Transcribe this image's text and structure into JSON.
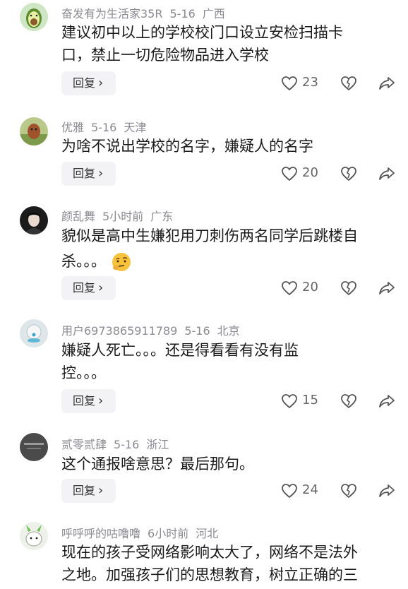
{
  "comments": [
    {
      "username": "奋发有为生活家35R",
      "date": "5-16",
      "location": "广西",
      "text_lines": [
        "建议初中以上的学校校门口设立安检扫描卡",
        "口，禁止一切危险物品进入学校"
      ],
      "reply_label": "回复",
      "like_count": "23",
      "avatar": "avocado-avatar"
    },
    {
      "username": "优雅",
      "date": "5-16",
      "location": "天津",
      "text_lines": [
        "为啥不说出学校的名字，嫌疑人的名字"
      ],
      "reply_label": "回复",
      "like_count": "20",
      "avatar": "outdoor-photo-avatar"
    },
    {
      "username": "颜乱舞",
      "date": "5小时前",
      "location": "广东",
      "text_lines": [
        "貌似是高中生嫌犯用刀刺伤两名同学后跳楼自",
        "杀。。。"
      ],
      "emoji": "thinking-face-emoji",
      "reply_label": "回复",
      "like_count": "20",
      "avatar": "dark-portrait-avatar"
    },
    {
      "username": "用户6973865911789",
      "date": "5-16",
      "location": "北京",
      "text_lines": [
        "嫌疑人死亡。。。还是得看看有没有监",
        "控。。。"
      ],
      "reply_label": "回复",
      "like_count": "15",
      "avatar": "default-user-avatar"
    },
    {
      "username": "贰零贰肆",
      "date": "5-16",
      "location": "浙江",
      "text_lines": [
        "这个通报啥意思？最后那句。"
      ],
      "reply_label": "回复",
      "like_count": "24",
      "avatar": "gray-text-avatar"
    },
    {
      "username": "呼呼呼的咕噜噜",
      "date": "6小时前",
      "location": "河北",
      "text_lines": [
        "现在的孩子受网络影响太大了，网络不是法外",
        "之地。加强孩子们的思想教育，树立正确的三"
      ],
      "avatar": "cartoon-avatar"
    }
  ]
}
